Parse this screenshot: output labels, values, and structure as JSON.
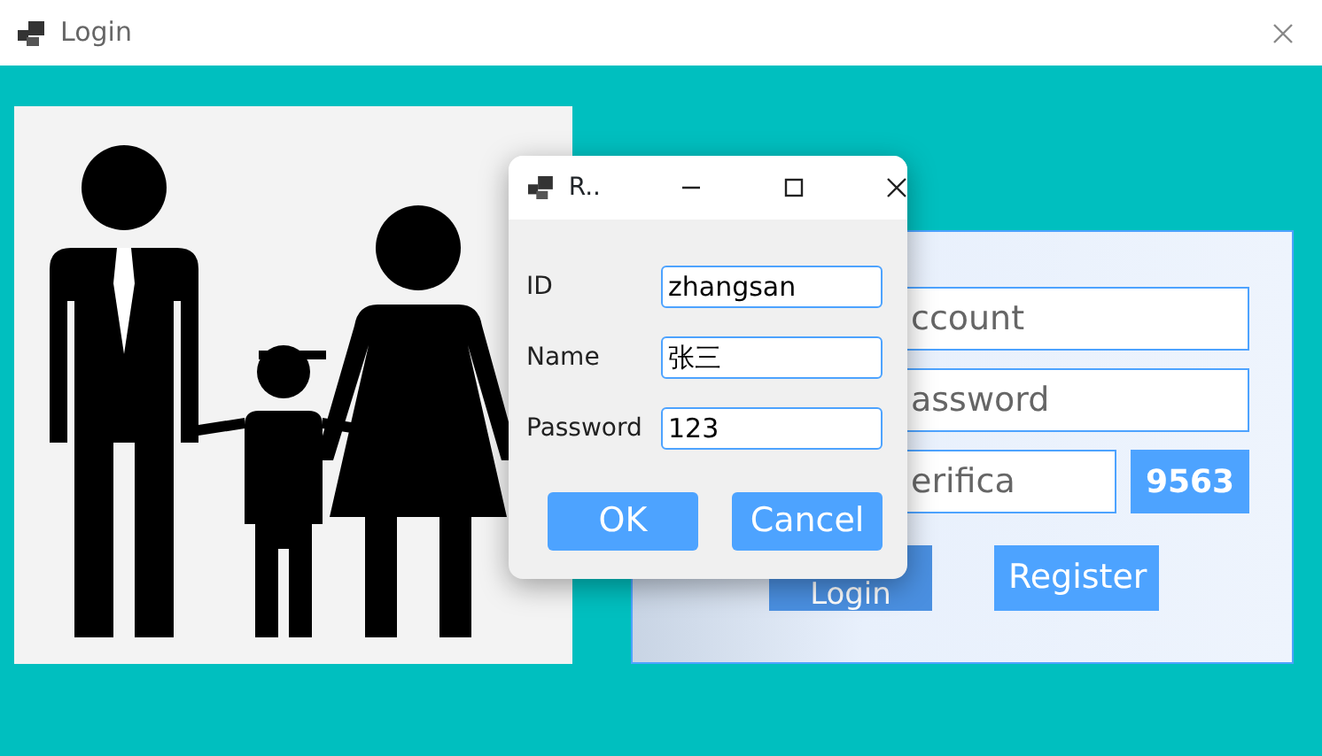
{
  "window": {
    "title": "Login"
  },
  "login_form": {
    "fields": [
      {
        "placeholder": "ccount"
      },
      {
        "placeholder": "assword"
      },
      {
        "placeholder": "erifica"
      }
    ],
    "captcha": "9563",
    "buttons": [
      {
        "label": "Login",
        "kind": "primary"
      },
      {
        "label": "Register",
        "kind": "secondary"
      }
    ]
  },
  "dialog": {
    "title": "R..",
    "fields": [
      {
        "label": "ID",
        "value": "zhangsan"
      },
      {
        "label": "Name",
        "value": "张三"
      },
      {
        "label": "Password",
        "value": "123"
      }
    ],
    "buttons": [
      "OK",
      "Cancel"
    ]
  }
}
